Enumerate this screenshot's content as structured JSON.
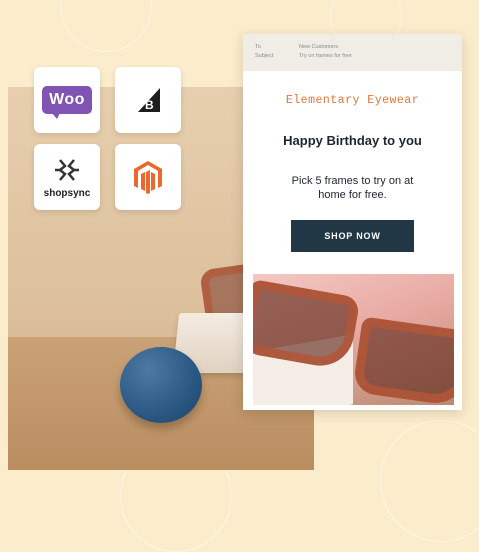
{
  "integrations": {
    "logos": [
      {
        "name": "woocommerce",
        "label": "Woo"
      },
      {
        "name": "bigcommerce",
        "label": "B"
      },
      {
        "name": "shopsync",
        "label": "shopsync"
      },
      {
        "name": "magento",
        "label": ""
      }
    ]
  },
  "email": {
    "to_label": "To",
    "to_value": "New Customers",
    "subject_label": "Subject",
    "subject_value": "Try on frames for free",
    "brand": "Elementary Eyewear",
    "headline": "Happy Birthday to you",
    "body": "Pick 5 frames to try on at home for free.",
    "cta_label": "SHOP NOW"
  },
  "colors": {
    "background": "#fbeccb",
    "woo_purple": "#7f54b3",
    "magento_orange": "#ee672f",
    "brand_orange": "#e0773a",
    "cta_navy": "#223746"
  }
}
